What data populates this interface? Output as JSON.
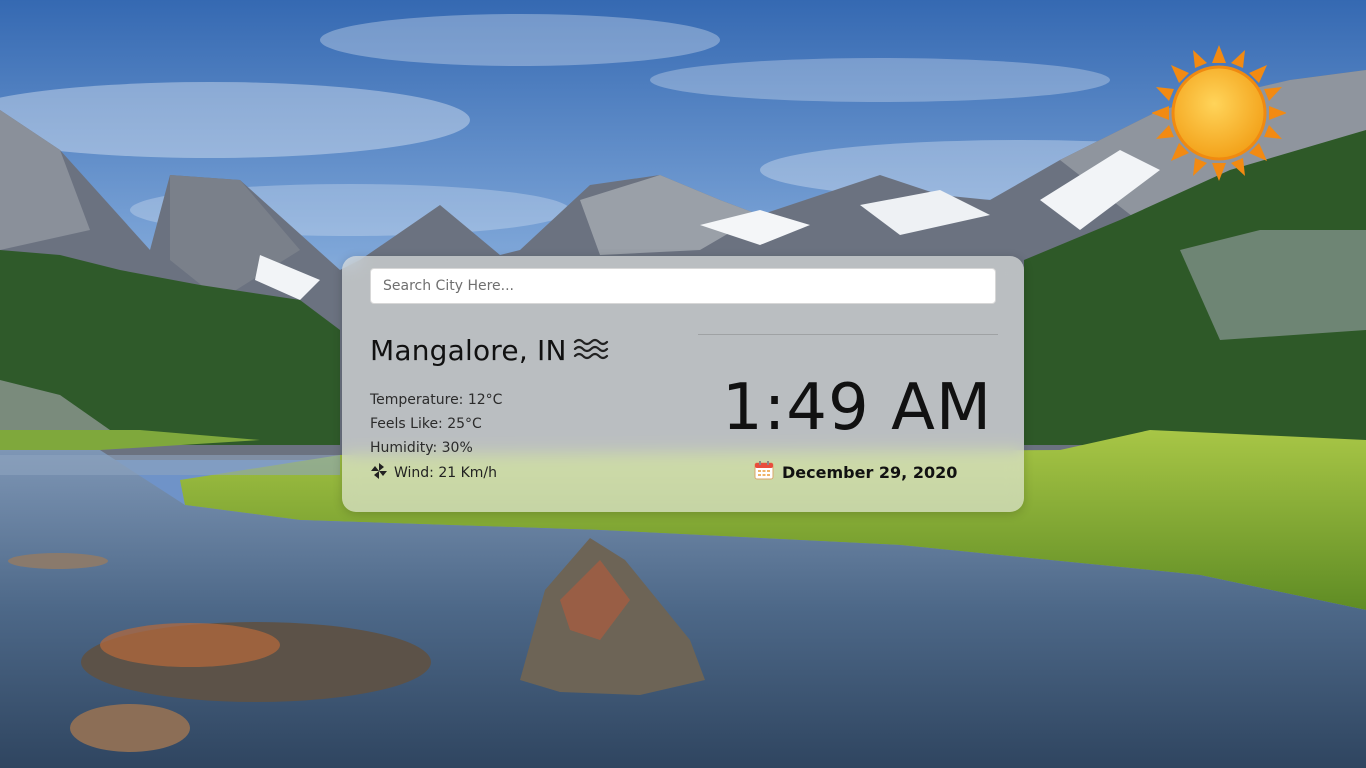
{
  "colors": {
    "sky_top": "#3a6fb6",
    "sky_bottom": "#c9dcf0",
    "card_bg": "#eceee8",
    "text_dark": "#111111",
    "sun_orange": "#f59b17",
    "calendar_red": "#e84c3d"
  },
  "icons": {
    "city": "waves-icon",
    "wind": "wind-pinwheel-icon",
    "date": "calendar-icon",
    "weather": "sun-icon"
  },
  "search": {
    "placeholder": "Search City Here..."
  },
  "location": {
    "city": "Mangalore, IN"
  },
  "weather": {
    "temperature": "Temperature: 12°C",
    "feels_like": "Feels Like: 25°C",
    "humidity": "Humidity: 30%",
    "wind": "Wind: 21 Km/h"
  },
  "clock": {
    "time": "1:49 AM",
    "date": "December 29, 2020"
  }
}
